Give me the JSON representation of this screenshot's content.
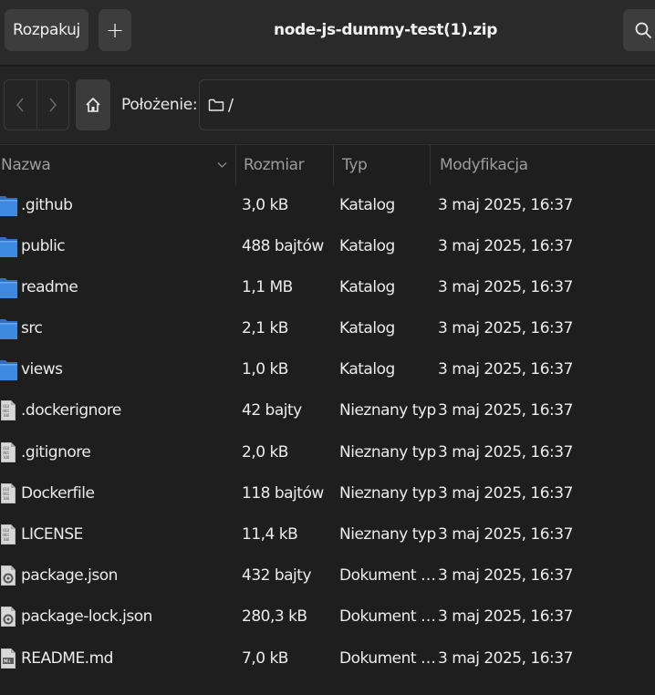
{
  "header": {
    "extract_label": "Rozpakuj",
    "add_label": "+",
    "title": "node-js-dummy-test(1).zip"
  },
  "location": {
    "label": "Położenie:",
    "path": "/"
  },
  "columns": {
    "name": "Nazwa",
    "size": "Rozmiar",
    "type": "Typ",
    "modified": "Modyfikacja",
    "sort_icon": "chevron-down-icon"
  },
  "files": [
    {
      "name": ".github",
      "size": "3,0 kB",
      "type": "Katalog",
      "modified": "3 maj 2025, 16:37",
      "icon": "folder-icon"
    },
    {
      "name": "public",
      "size": "488 bajtów",
      "type": "Katalog",
      "modified": "3 maj 2025, 16:37",
      "icon": "folder-icon"
    },
    {
      "name": "readme",
      "size": "1,1 MB",
      "type": "Katalog",
      "modified": "3 maj 2025, 16:37",
      "icon": "folder-icon"
    },
    {
      "name": "src",
      "size": "2,1 kB",
      "type": "Katalog",
      "modified": "3 maj 2025, 16:37",
      "icon": "folder-icon"
    },
    {
      "name": "views",
      "size": "1,0 kB",
      "type": "Katalog",
      "modified": "3 maj 2025, 16:37",
      "icon": "folder-icon"
    },
    {
      "name": ".dockerignore",
      "size": "42 bajty",
      "type": "Nieznany typ",
      "modified": "3 maj 2025, 16:37",
      "icon": "binary-file-icon"
    },
    {
      "name": ".gitignore",
      "size": "2,0 kB",
      "type": "Nieznany typ",
      "modified": "3 maj 2025, 16:37",
      "icon": "binary-file-icon"
    },
    {
      "name": "Dockerfile",
      "size": "118 bajtów",
      "type": "Nieznany typ",
      "modified": "3 maj 2025, 16:37",
      "icon": "binary-file-icon"
    },
    {
      "name": "LICENSE",
      "size": "11,4 kB",
      "type": "Nieznany typ",
      "modified": "3 maj 2025, 16:37",
      "icon": "binary-file-icon"
    },
    {
      "name": "package.json",
      "size": "432 bajty",
      "type": "Dokument …",
      "modified": "3 maj 2025, 16:37",
      "icon": "json-file-icon"
    },
    {
      "name": "package-lock.json",
      "size": "280,3 kB",
      "type": "Dokument …",
      "modified": "3 maj 2025, 16:37",
      "icon": "json-file-icon"
    },
    {
      "name": "README.md",
      "size": "7,0 kB",
      "type": "Dokument …",
      "modified": "3 maj 2025, 16:37",
      "icon": "markdown-file-icon"
    }
  ],
  "colors": {
    "folder": "#3d8ae0",
    "folder_back": "#2f6fbf",
    "background": "#1e1e1e",
    "headerbar": "#2a2a2a"
  }
}
